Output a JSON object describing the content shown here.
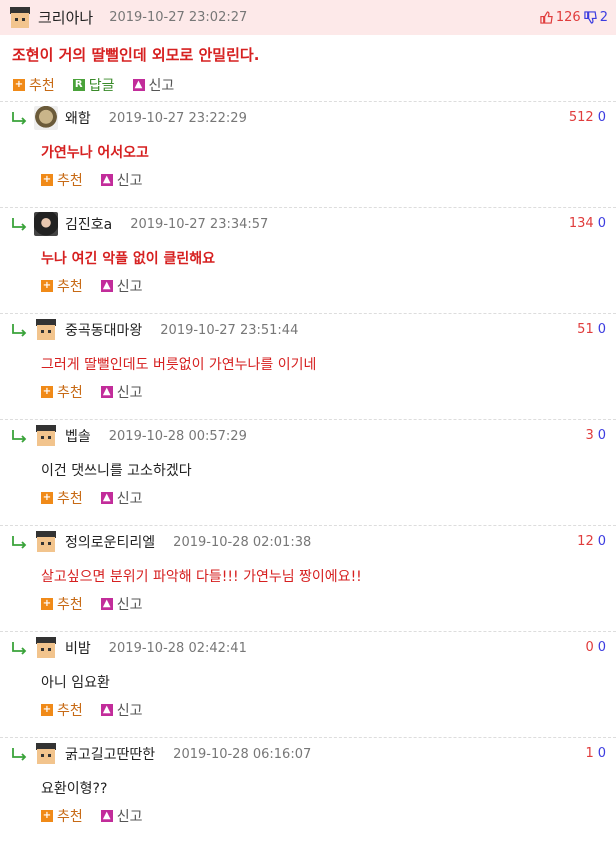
{
  "post": {
    "nick": "크리아나",
    "date": "2019-10-27 23:02:27",
    "up": "126",
    "down": "2",
    "content": "조현이 거의 딸뻘인데 외모로 안밀린다.",
    "recommend_label": "추천",
    "reply_label": "답글",
    "report_label": "신고"
  },
  "replies": [
    {
      "nick": "왜함",
      "date": "2019-10-27 23:22:29",
      "up": "512",
      "down": "0",
      "text": "가연누나 어서오고",
      "style": "bold-red"
    },
    {
      "nick": "김진호a",
      "date": "2019-10-27 23:34:57",
      "up": "134",
      "down": "0",
      "text": "누나 여긴 악플 없이 클린해요",
      "style": "bold-red"
    },
    {
      "nick": "중곡동대마왕",
      "date": "2019-10-27 23:51:44",
      "up": "51",
      "down": "0",
      "text": "그러게 딸뻘인데도 버릇없이 가연누나를 이기네",
      "style": "red"
    },
    {
      "nick": "벱솔",
      "date": "2019-10-28 00:57:29",
      "up": "3",
      "down": "0",
      "text": "이건 댓쓰니를 고소하겠다",
      "style": "black"
    },
    {
      "nick": "정의로운티리엘",
      "date": "2019-10-28 02:01:38",
      "up": "12",
      "down": "0",
      "text": "살고싶으면 분위기 파악해 다들!!! 가연누님 짱이에요!!",
      "style": "red"
    },
    {
      "nick": "비밤",
      "date": "2019-10-28 02:42:41",
      "up": "0",
      "down": "0",
      "text": "아니 임요환",
      "style": "black"
    },
    {
      "nick": "굵고길고딴딴한",
      "date": "2019-10-28 06:16:07",
      "up": "1",
      "down": "0",
      "text": "요환이형??",
      "style": "black"
    }
  ],
  "labels": {
    "recommend": "추천",
    "report": "신고"
  },
  "colors": {
    "header_bg": "#fde9e9",
    "up": "#e03c3c",
    "down": "#3c3ce0",
    "accent": "#c76a15"
  }
}
